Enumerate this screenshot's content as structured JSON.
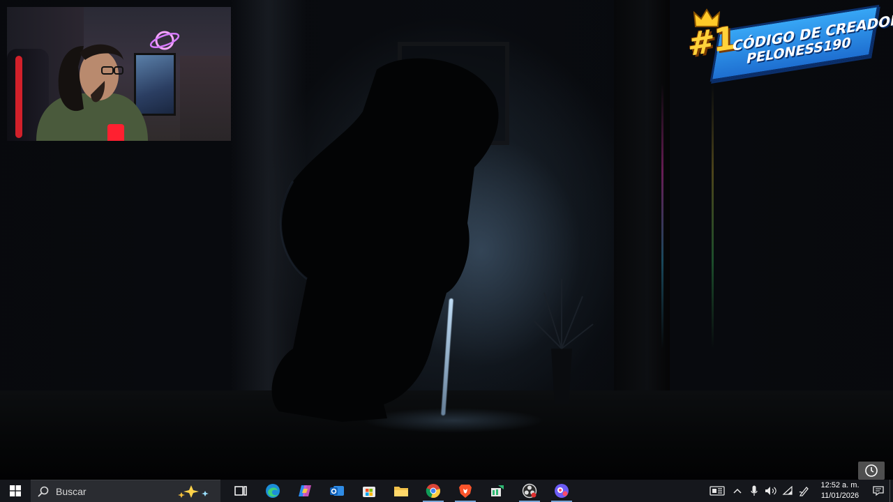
{
  "overlay": {
    "badge": {
      "number": "#1",
      "line1": "CÓDIGO DE CREADOR:",
      "line2": "PELONESS190"
    }
  },
  "taskbar": {
    "search_placeholder": "Buscar",
    "pinned": [
      {
        "name": "task-view"
      },
      {
        "name": "edge"
      },
      {
        "name": "copilot"
      },
      {
        "name": "outlook"
      },
      {
        "name": "microsoft-store"
      },
      {
        "name": "file-explorer"
      },
      {
        "name": "chrome"
      },
      {
        "name": "brave"
      },
      {
        "name": "app-green"
      },
      {
        "name": "obs"
      },
      {
        "name": "app-purple"
      }
    ],
    "clock": {
      "time": "12:52 a. m.",
      "date": "11/01/2026"
    }
  }
}
